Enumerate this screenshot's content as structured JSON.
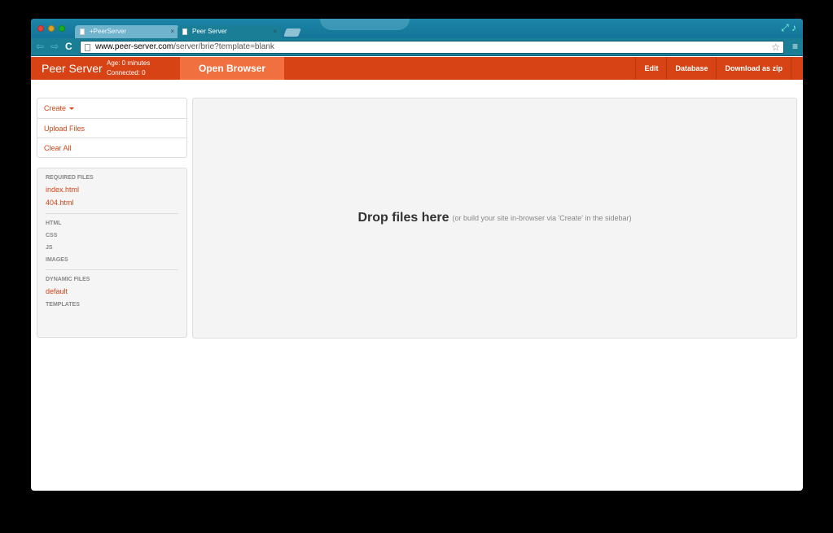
{
  "browser": {
    "tabs": [
      {
        "title": "+PeerServer",
        "close": "×"
      },
      {
        "title": "Peer Server",
        "close": "×"
      }
    ],
    "url_domain": "www.peer-server.com",
    "url_path": "/server/brie?template=blank",
    "nav": {
      "back": "⇦",
      "forward": "⇨",
      "reload": "C"
    },
    "star": "☆",
    "menu": "≡"
  },
  "app": {
    "brand": "Peer Server",
    "age": "Age: 0 minutes",
    "connected": "Connected: 0",
    "open_browser": "Open Browser",
    "nav_links": [
      "Edit",
      "Database",
      "Download as zip"
    ]
  },
  "sidebar": {
    "actions": [
      "Create",
      "Upload Files",
      "Clear All"
    ],
    "sections": {
      "required": "REQUIRED FILES",
      "required_files": [
        "index.html",
        "404.html"
      ],
      "html": "HTML",
      "css": "CSS",
      "js": "JS",
      "images": "IMAGES",
      "dynamic": "DYNAMIC FILES",
      "dynamic_files": [
        "default"
      ],
      "templates": "TEMPLATES"
    }
  },
  "dropzone": {
    "main": "Drop files here",
    "sub": "(or build your site in-browser via 'Create' in the sidebar)"
  },
  "colors": {
    "accent": "#d84315",
    "accent_light": "#f07040",
    "chrome": "#1a7f96"
  }
}
